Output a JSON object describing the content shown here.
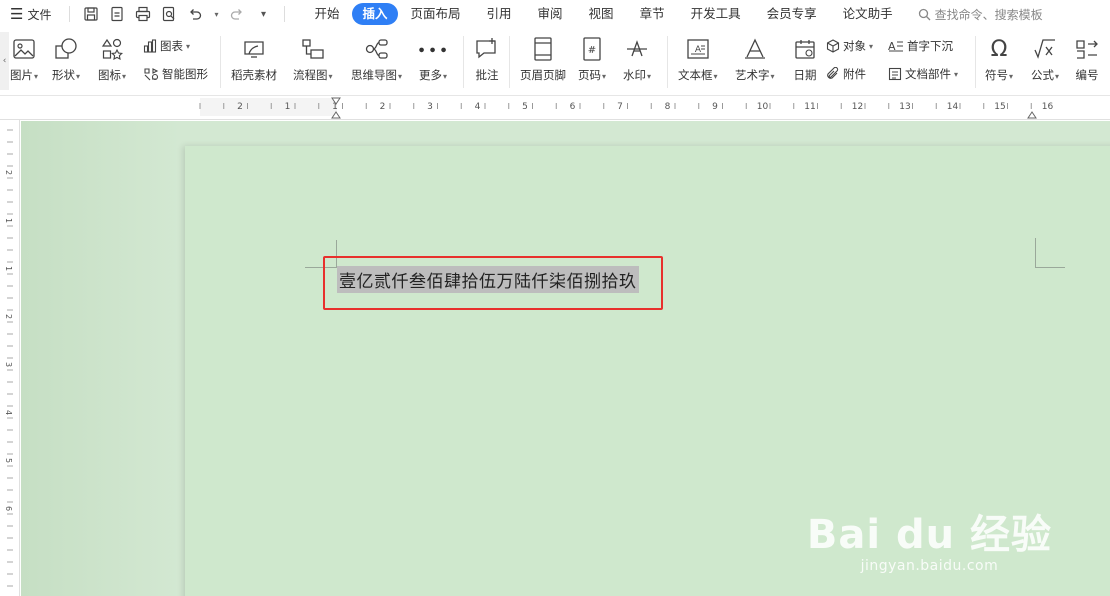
{
  "menubar": {
    "file_label": "文件",
    "tabs": [
      {
        "label": "开始"
      },
      {
        "label": "插入",
        "active": true
      },
      {
        "label": "页面布局"
      },
      {
        "label": "引用"
      },
      {
        "label": "审阅"
      },
      {
        "label": "视图"
      },
      {
        "label": "章节"
      },
      {
        "label": "开发工具"
      },
      {
        "label": "会员专享"
      },
      {
        "label": "论文助手"
      }
    ],
    "search_placeholder": "查找命令、搜索模板",
    "accent_color": "#2f7ff5"
  },
  "ribbon": {
    "picture": "图片",
    "shape": "形状",
    "icon": "图标",
    "chart": "图表",
    "smart_art": "智能图形",
    "material": "稻壳素材",
    "flowchart": "流程图",
    "mindmap": "思维导图",
    "more": "更多",
    "comment": "批注",
    "header_footer": "页眉页脚",
    "page_number": "页码",
    "watermark": "水印",
    "textbox": "文本框",
    "wordart": "艺术字",
    "date": "日期",
    "object": "对象",
    "attachment": "附件",
    "drop_cap": "首字下沉",
    "doc_parts": "文档部件",
    "symbol": "符号",
    "formula": "公式",
    "numbering": "编号"
  },
  "ruler": {
    "h_labels": [
      "2",
      "1",
      "1",
      "2",
      "3",
      "4",
      "5",
      "6",
      "7",
      "8",
      "9",
      "10",
      "11",
      "12",
      "13",
      "14",
      "15",
      "16"
    ],
    "v_labels": [
      "2",
      "1",
      "1",
      "2",
      "3",
      "4",
      "5",
      "6"
    ]
  },
  "document": {
    "text": "壹亿贰仟叁佰肆拾伍万陆仟柒佰捌拾玖",
    "highlight_color": "#e8302c",
    "page_color": "#cfe8cd"
  },
  "watermark": {
    "logo_text": "Bai du 经验",
    "url": "jingyan.baidu.com"
  }
}
